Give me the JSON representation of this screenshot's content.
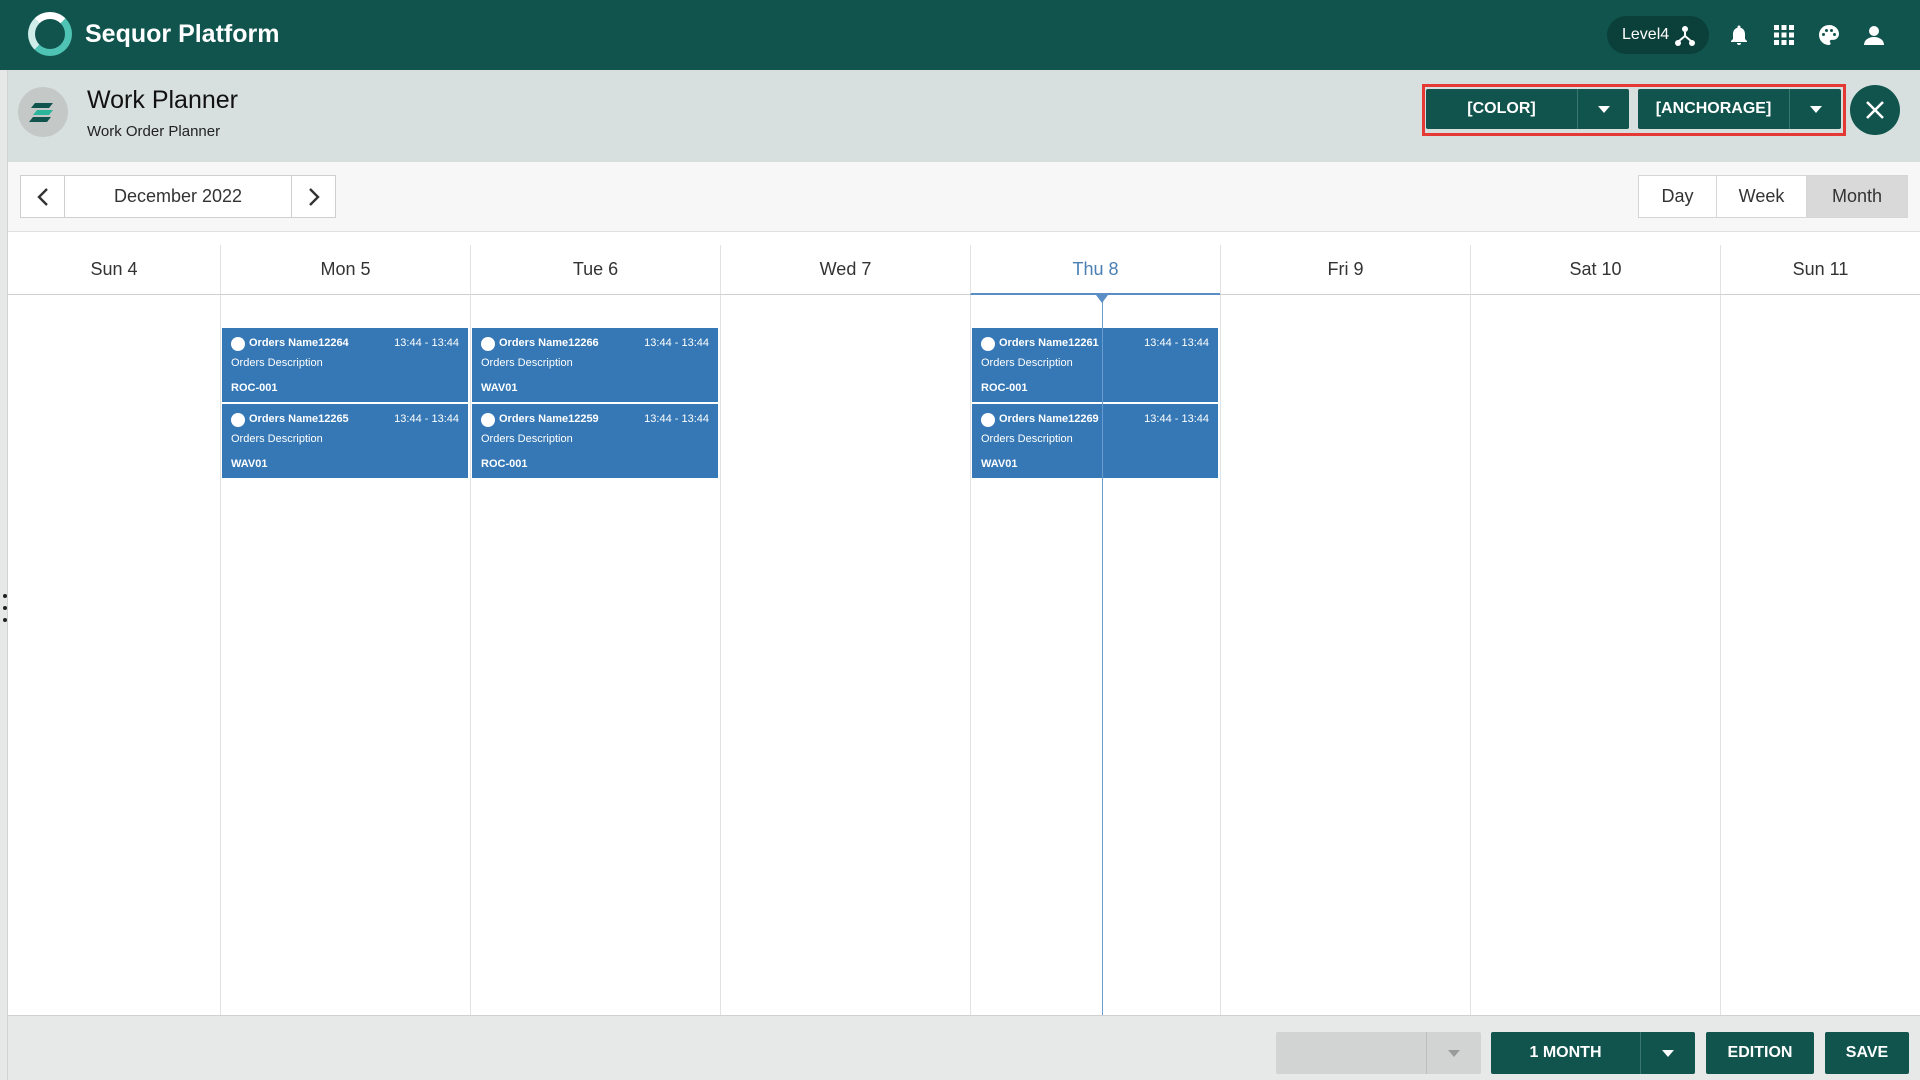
{
  "app": {
    "title": "Sequor Platform",
    "level": "Level4"
  },
  "header": {
    "title": "Work Planner",
    "subtitle": "Work Order Planner"
  },
  "filters": {
    "color_label": "[COLOR]",
    "anchorage_label": "[ANCHORAGE]"
  },
  "toolbar": {
    "date_label": "December 2022",
    "views": [
      "Day",
      "Week",
      "Month"
    ],
    "selected_view": "Month"
  },
  "calendar": {
    "days": [
      "Sun 4",
      "Mon 5",
      "Tue 6",
      "Wed 7",
      "Thu 8",
      "Fri 9",
      "Sat 10",
      "Sun 11"
    ],
    "today": "Thu 8",
    "events": [
      {
        "day": "Mon 5",
        "name": "Orders Name12264",
        "time": "13:44 - 13:44",
        "desc": "Orders Description",
        "resource": "ROC-001"
      },
      {
        "day": "Mon 5",
        "name": "Orders Name12265",
        "time": "13:44 - 13:44",
        "desc": "Orders Description",
        "resource": "WAV01"
      },
      {
        "day": "Tue 6",
        "name": "Orders Name12266",
        "time": "13:44 - 13:44",
        "desc": "Orders Description",
        "resource": "WAV01"
      },
      {
        "day": "Tue 6",
        "name": "Orders Name12259",
        "time": "13:44 - 13:44",
        "desc": "Orders Description",
        "resource": "ROC-001"
      },
      {
        "day": "Thu 8",
        "name": "Orders Name12261",
        "time": "13:44 - 13:44",
        "desc": "Orders Description",
        "resource": "ROC-001"
      },
      {
        "day": "Thu 8",
        "name": "Orders Name12269",
        "time": "13:44 - 13:44",
        "desc": "Orders Description",
        "resource": "WAV01"
      }
    ]
  },
  "footer": {
    "empty_select_label": "",
    "range_label": "1 MONTH",
    "edition_label": "EDITION",
    "save_label": "SAVE"
  },
  "colors": {
    "primary": "#10544d",
    "event": "#3578b5",
    "today": "#4a7fb3",
    "highlight": "#e53935"
  },
  "icons": [
    "refresh-logo-icon",
    "hierarchy-icon",
    "bell-icon",
    "apps-grid-icon",
    "palette-icon",
    "user-icon",
    "close-icon",
    "chevron-left-icon",
    "chevron-right-icon",
    "caret-down-icon"
  ]
}
